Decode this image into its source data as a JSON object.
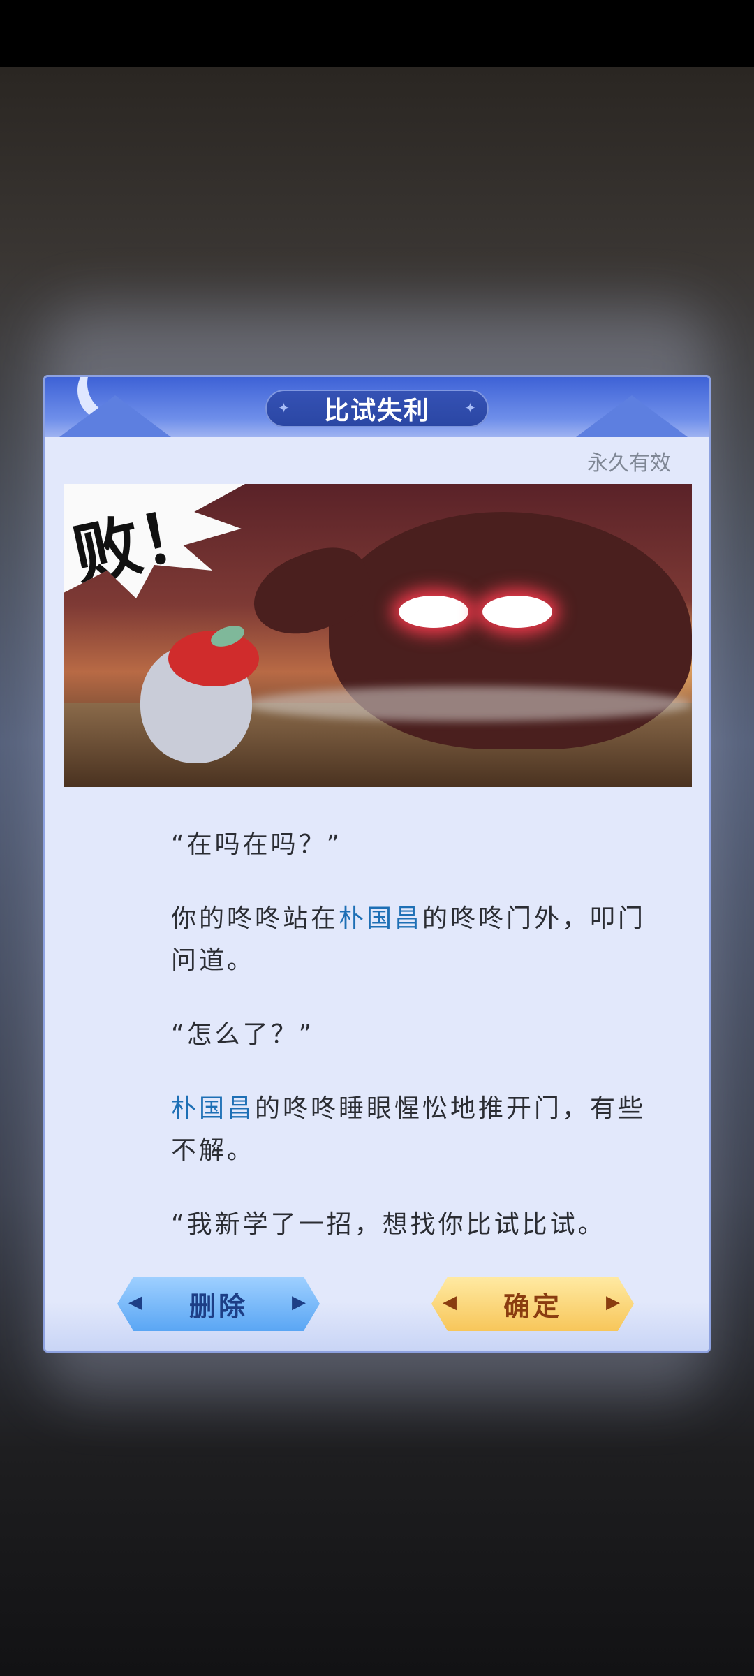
{
  "dialog": {
    "title": "比试失利",
    "validity": "永久有效",
    "illustration": {
      "icon": "defeat-illustration",
      "exclaim": "败！"
    },
    "paragraphs": {
      "p1": "“在吗在吗？”",
      "p2_a": "你的咚咚站在",
      "p2_name": "朴国昌",
      "p2_b": "的咚咚门外，叩门问道。",
      "p3": "“怎么了？”",
      "p4_name": "朴国昌",
      "p4_b": "的咚咚睡眼惺忪地推开门，有些不解。",
      "p5": "“我新学了一招，想找你比试比试。"
    },
    "buttons": {
      "delete_label": "删除",
      "confirm_label": "确定"
    }
  },
  "colors": {
    "header_blue": "#3e62d6",
    "dialog_bg": "#e2e8fb",
    "name_highlight": "#1d6fb5",
    "delete_button": "#5aa6f4",
    "confirm_button": "#f7c65a"
  }
}
